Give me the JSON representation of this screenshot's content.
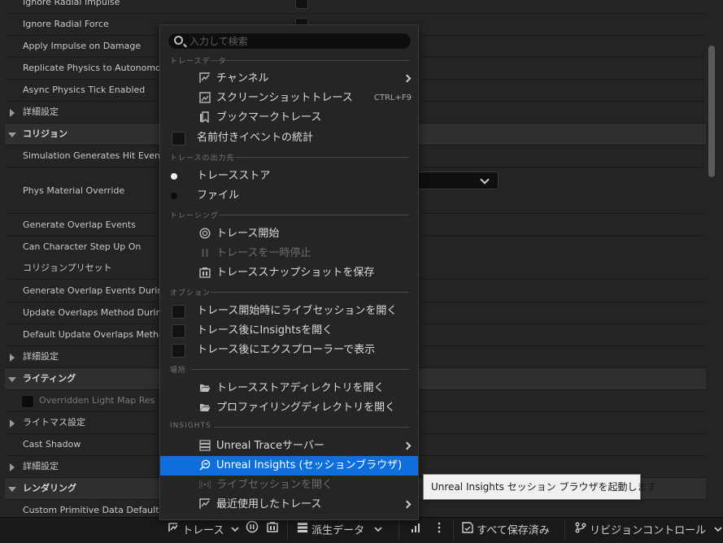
{
  "details_panel": {
    "rows": [
      {
        "label": "Ignore Radial Impulse",
        "kind": "prop",
        "checkbox": true
      },
      {
        "label": "Ignore Radial Force",
        "kind": "prop",
        "checkbox": true
      },
      {
        "label": "Apply Impulse on Damage",
        "kind": "prop"
      },
      {
        "label": "Replicate Physics to Autonomous",
        "kind": "prop"
      },
      {
        "label": "Async Physics Tick Enabled",
        "kind": "prop"
      },
      {
        "label": "詳細設定",
        "kind": "section"
      },
      {
        "label": "コリジョン",
        "kind": "category"
      },
      {
        "label": "Simulation Generates Hit Events",
        "kind": "prop"
      },
      {
        "label": "Phys Material Override",
        "kind": "prop-tall"
      },
      {
        "label": "Generate Overlap Events",
        "kind": "prop"
      },
      {
        "label": "Can Character Step Up On",
        "kind": "prop"
      },
      {
        "label": "コリジョンプリセット",
        "kind": "prop"
      },
      {
        "label": "Generate Overlap Events During L",
        "kind": "prop"
      },
      {
        "label": "Update Overlaps Method During L",
        "kind": "prop"
      },
      {
        "label": "Default Update Overlaps Method D",
        "kind": "prop"
      },
      {
        "label": "詳細設定",
        "kind": "section"
      },
      {
        "label": "ライティング",
        "kind": "category"
      },
      {
        "label": "Overridden Light Map Res",
        "kind": "disabled"
      },
      {
        "label": "ライトマス設定",
        "kind": "section"
      },
      {
        "label": "Cast Shadow",
        "kind": "prop"
      },
      {
        "label": "詳細設定",
        "kind": "section"
      },
      {
        "label": "レンダリング",
        "kind": "category"
      },
      {
        "label": "Custom Primitive Data Defaults",
        "kind": "prop"
      }
    ]
  },
  "menu": {
    "search_placeholder": "入力して検索",
    "sections": {
      "trace_data": "トレースデータ",
      "trace_output": "トレースの出力先",
      "tracing": "トレーシング",
      "options": "オプション",
      "location": "場所",
      "insights": "INSIGHTS"
    },
    "items": {
      "channels": "チャンネル",
      "screenshot_trace": "スクリーンショットトレース",
      "screenshot_shortcut": "CTRL+F9",
      "bookmark_trace": "ブックマークトレース",
      "named_event_stats": "名前付きイベントの統計",
      "trace_store": "トレースストア",
      "file": "ファイル",
      "start_trace": "トレース開始",
      "pause_trace": "トレースを一時停止",
      "save_snapshot": "トレーススナップショットを保存",
      "open_live_session": "トレース開始時にライブセッションを開く",
      "open_insights_after": "トレース後にInsightsを開く",
      "show_in_explorer_after": "トレース後にエクスプローラーで表示",
      "open_trace_store_dir": "トレースストアディレクトリを開く",
      "open_profiling_dir": "プロファイリングディレクトリを開く",
      "unreal_trace_server": "Unreal Traceサーバー",
      "unreal_insights_browser": "Unreal Insights (セッションブラウザ)",
      "open_live_session_item": "ライブセッションを開く",
      "recent_traces": "最近使用したトレース"
    },
    "tooltip": "Unreal Insights セッション ブラウザを起動します"
  },
  "statusbar": {
    "trace": "トレース",
    "derived_data": "派生データ",
    "all_saved": "すべて保存済み",
    "revision_control": "リビジョンコントロール"
  },
  "colors": {
    "highlight": "#0e6fdc",
    "panel_bg": "#242424",
    "menu_bg": "#252525"
  }
}
